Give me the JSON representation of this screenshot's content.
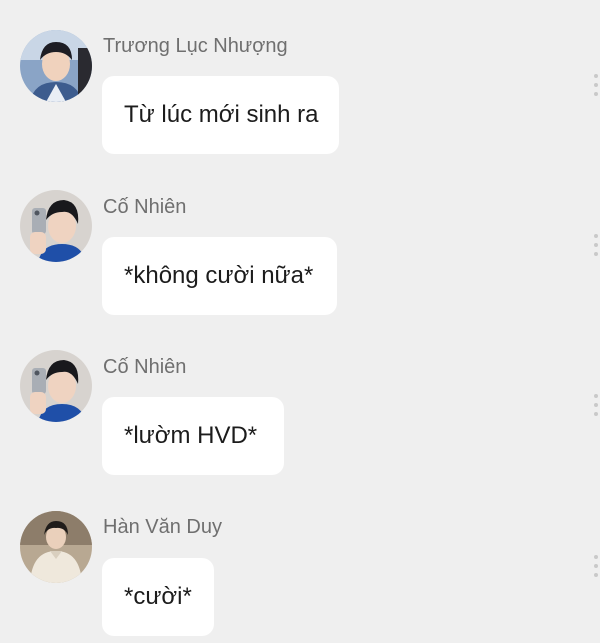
{
  "messages": [
    {
      "sender": "Trương Lục Nhượng",
      "text": "Từ lúc mới sinh ra",
      "avatar_icon": "avatar-boy-dark-hair"
    },
    {
      "sender": "Cố Nhiên",
      "text": "*không cười nữa*",
      "avatar_icon": "avatar-boy-phone-selfie"
    },
    {
      "sender": "Cố Nhiên",
      "text": "*lườm HVD*",
      "avatar_icon": "avatar-boy-phone-selfie"
    },
    {
      "sender": "Hàn Văn Duy",
      "text": "*cười*",
      "avatar_icon": "avatar-boy-sweater"
    }
  ],
  "colors": {
    "background": "#efefef",
    "bubble": "#ffffff",
    "sender_text": "#6f6f6f",
    "message_text": "#1c1c1c"
  },
  "icons": {
    "more_menu": "more-vertical-icon"
  }
}
